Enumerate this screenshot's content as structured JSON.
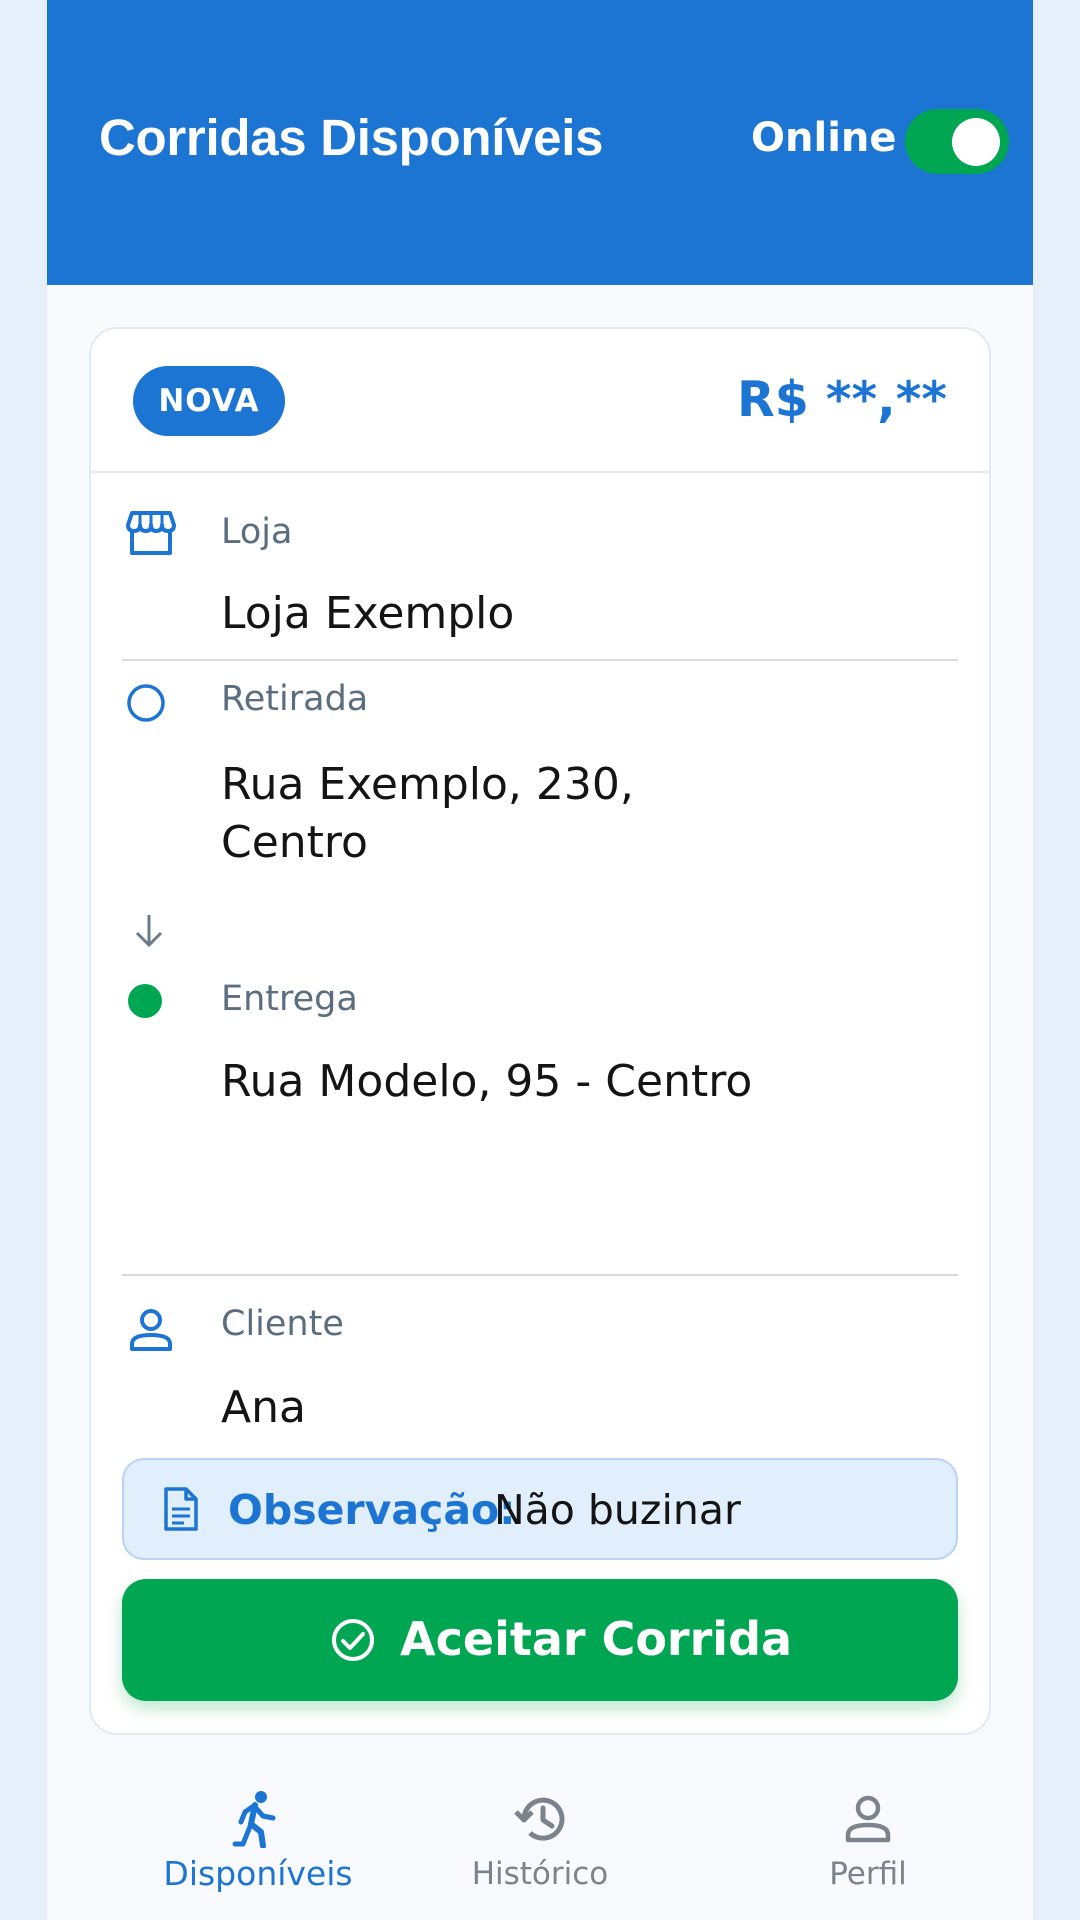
{
  "header": {
    "title": "Corridas Disponíveis",
    "status_label": "Online",
    "online_toggle": true
  },
  "ride_card": {
    "badge": "NOVA",
    "price": "R$ **,**",
    "store": {
      "label": "Loja",
      "value": "Loja Exemplo",
      "icon": "store-icon"
    },
    "pickup": {
      "label": "Retirada",
      "value_line1": "Rua Exemplo, 230,",
      "value_line2": "Centro",
      "icon": "pickup-circle-icon"
    },
    "delivery": {
      "label": "Entrega",
      "value": "Rua Modelo, 95 - Centro",
      "icon": "delivery-dot-icon"
    },
    "client": {
      "label": "Cliente",
      "value": "Ana",
      "icon": "person-icon"
    },
    "note": {
      "label": "Observação:",
      "value": "Não buzinar",
      "icon": "document-icon"
    },
    "accept_button": {
      "label": "Aceitar Corrida",
      "icon": "check-circle-icon"
    }
  },
  "bottom_nav": {
    "items": [
      {
        "label": "Disponíveis",
        "icon": "running-person-icon",
        "active": true
      },
      {
        "label": "Histórico",
        "icon": "history-icon",
        "active": false
      },
      {
        "label": "Perfil",
        "icon": "profile-icon",
        "active": false
      }
    ]
  },
  "colors": {
    "primary": "#1c74d3",
    "success": "#00a651",
    "background": "#e6f0fb"
  }
}
